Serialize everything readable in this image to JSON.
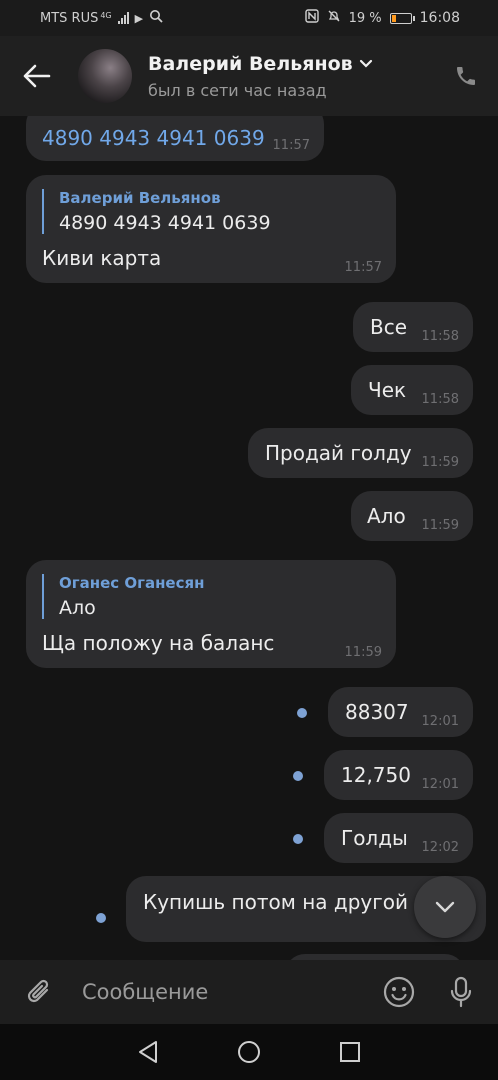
{
  "status_bar": {
    "carrier": "MTS RUS",
    "network": "4G",
    "battery": "19 %",
    "time": "16:08"
  },
  "header": {
    "contact_name": "Валерий Вельянов",
    "contact_status": "был в сети час назад"
  },
  "messages": [
    {
      "text": "4890 4943 4941 0639",
      "time": "11:57",
      "direction": "incoming"
    },
    {
      "quote_author": "Валерий Вельянов",
      "quote_text": "4890 4943 4941 0639",
      "text": "Киви карта",
      "time": "11:57",
      "direction": "incoming"
    },
    {
      "text": "Все",
      "time": "11:58",
      "direction": "outgoing"
    },
    {
      "text": "Чек",
      "time": "11:58",
      "direction": "outgoing"
    },
    {
      "text": "Продай голду",
      "time": "11:59",
      "direction": "outgoing"
    },
    {
      "text": "Ало",
      "time": "11:59",
      "direction": "outgoing"
    },
    {
      "quote_author": "Оганес Оганесян",
      "quote_text": "Ало",
      "text": "Ща положу на баланс",
      "time": "11:59",
      "direction": "incoming"
    },
    {
      "text": "88307",
      "time": "12:01",
      "direction": "outgoing",
      "unread": true
    },
    {
      "text": "12,750",
      "time": "12:01",
      "direction": "outgoing",
      "unread": true
    },
    {
      "text": "Голды",
      "time": "12:02",
      "direction": "outgoing",
      "unread": true
    },
    {
      "text": "Купишь потом на другой а",
      "direction": "outgoing",
      "unread": true
    }
  ],
  "composer": {
    "placeholder": "Сообщение"
  },
  "colors": {
    "accent": "#71a8e9",
    "bubble": "#2c2c2e",
    "background": "#141414",
    "unread_dot": "#7ea2d4",
    "battery_low": "#ff9a1f"
  },
  "icons": [
    "back-arrow-icon",
    "chevron-down-icon",
    "phone-icon",
    "chevron-down-icon",
    "paperclip-icon",
    "emoji-icon",
    "microphone-icon",
    "nav-back-icon",
    "nav-home-icon",
    "nav-recents-icon"
  ]
}
